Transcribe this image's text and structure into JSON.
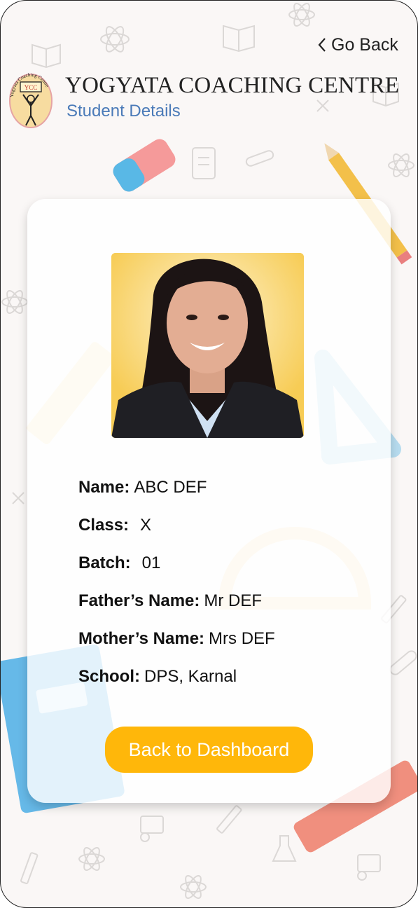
{
  "header": {
    "go_back_label": "Go Back",
    "brand_title": "YOGYATA COACHING CENTRE",
    "subtitle": "Student Details",
    "logo_text": "Yogyata Coaching Centre",
    "logo_badge": "YCC"
  },
  "student": {
    "fields": [
      {
        "label": "Name:",
        "value": "ABC DEF"
      },
      {
        "label": "Class:",
        "value": "X"
      },
      {
        "label": "Batch:",
        "value": "01"
      },
      {
        "label": "Father’s Name:",
        "value": "Mr DEF"
      },
      {
        "label": "Mother’s Name:",
        "value": "Mrs DEF"
      },
      {
        "label": "School:",
        "value": "DPS, Karnal"
      }
    ]
  },
  "actions": {
    "back_to_dashboard_label": "Back to Dashboard"
  },
  "colors": {
    "accent": "#ffb70a",
    "subtitle": "#4a7ab8",
    "photo_bg": "#f9cf62",
    "background": "#faf7f6"
  }
}
